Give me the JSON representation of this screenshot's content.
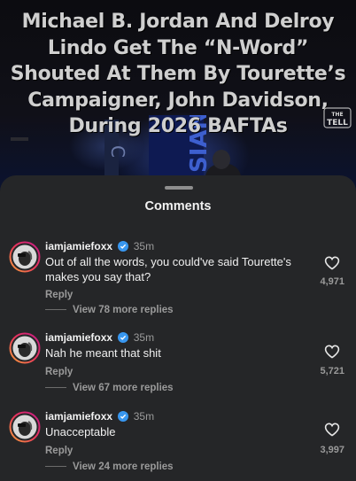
{
  "post": {
    "headline": "Michael B. Jordan And Delroy Lindo Get The “N-Word” Shouted At Them By Tourette’s Campaigner, John Davidson, During 2026 BAFTAs",
    "brand_logo_text": "THE TELL"
  },
  "sheet": {
    "title": "Comments"
  },
  "comments": [
    {
      "username": "iamjamiefoxx",
      "time": "35m",
      "text": "Out of all the words, you could've said Tourette's makes you say that?",
      "reply_label": "Reply",
      "view_replies": "View 78 more replies",
      "likes": "4,971"
    },
    {
      "username": "iamjamiefoxx",
      "time": "35m",
      "text": "Nah he meant that shit",
      "reply_label": "Reply",
      "view_replies": "View 67 more replies",
      "likes": "5,721"
    },
    {
      "username": "iamjamiefoxx",
      "time": "35m",
      "text": "Unacceptable",
      "reply_label": "Reply",
      "view_replies": "View 24 more replies",
      "likes": "3,997"
    }
  ],
  "colors": {
    "sheet_bg": "#252628",
    "verified_blue": "#3897f0",
    "muted_text": "#9a9a9a",
    "story_ring_start": "#f9a23b",
    "story_ring_end": "#c41b86"
  }
}
